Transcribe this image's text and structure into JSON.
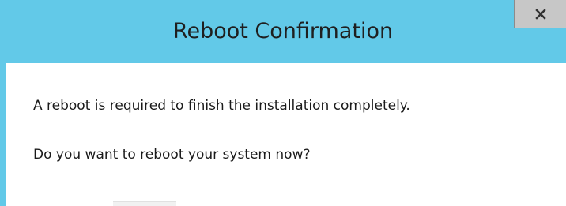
{
  "window": {
    "title": "Reboot Confirmation",
    "close_icon": "close-icon"
  },
  "content": {
    "messages": [
      "A reboot is required to finish the installation completely.",
      "Do you want to reboot your system now?"
    ]
  },
  "colors": {
    "frame": "#62c9e8",
    "title_text": "#1f1f1f",
    "close_button": "#c7c7c7",
    "body_background": "#ffffff"
  }
}
